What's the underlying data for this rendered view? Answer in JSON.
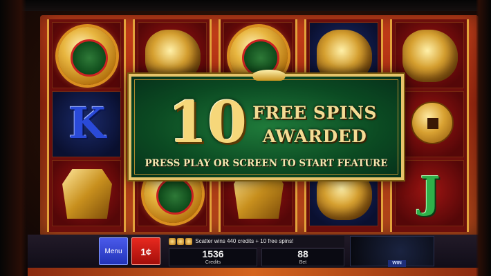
{
  "banner": {
    "spin_count": "10",
    "line1": "FREE SPINS",
    "line2": "AWARDED",
    "instruction": "PRESS PLAY OR SCREEN TO START FEATURE"
  },
  "reels": {
    "reel1": [
      "coin",
      "K",
      "gold-box"
    ],
    "reel2": [
      "dragon",
      "",
      "coin"
    ],
    "reel3": [
      "coin",
      "",
      "gold-box"
    ],
    "reel4": [
      "turtle",
      "",
      "turtle"
    ],
    "reel5": [
      "dragon",
      "coin",
      "J"
    ]
  },
  "controls": {
    "menu_label": "Menu",
    "denom_label": "1¢",
    "scatter_message": "Scatter wins 440 credits + 10 free spins!",
    "credits_value": "1536",
    "credits_label": "Credits",
    "bet_value": "88",
    "bet_label": "Bet",
    "win_label": "WIN"
  },
  "colors": {
    "banner_green": "#0b4a22",
    "gold_text": "#f4dc94",
    "reel_red": "#6b0f0c",
    "menu_blue": "#2233b8",
    "denom_red": "#a30e0a"
  }
}
